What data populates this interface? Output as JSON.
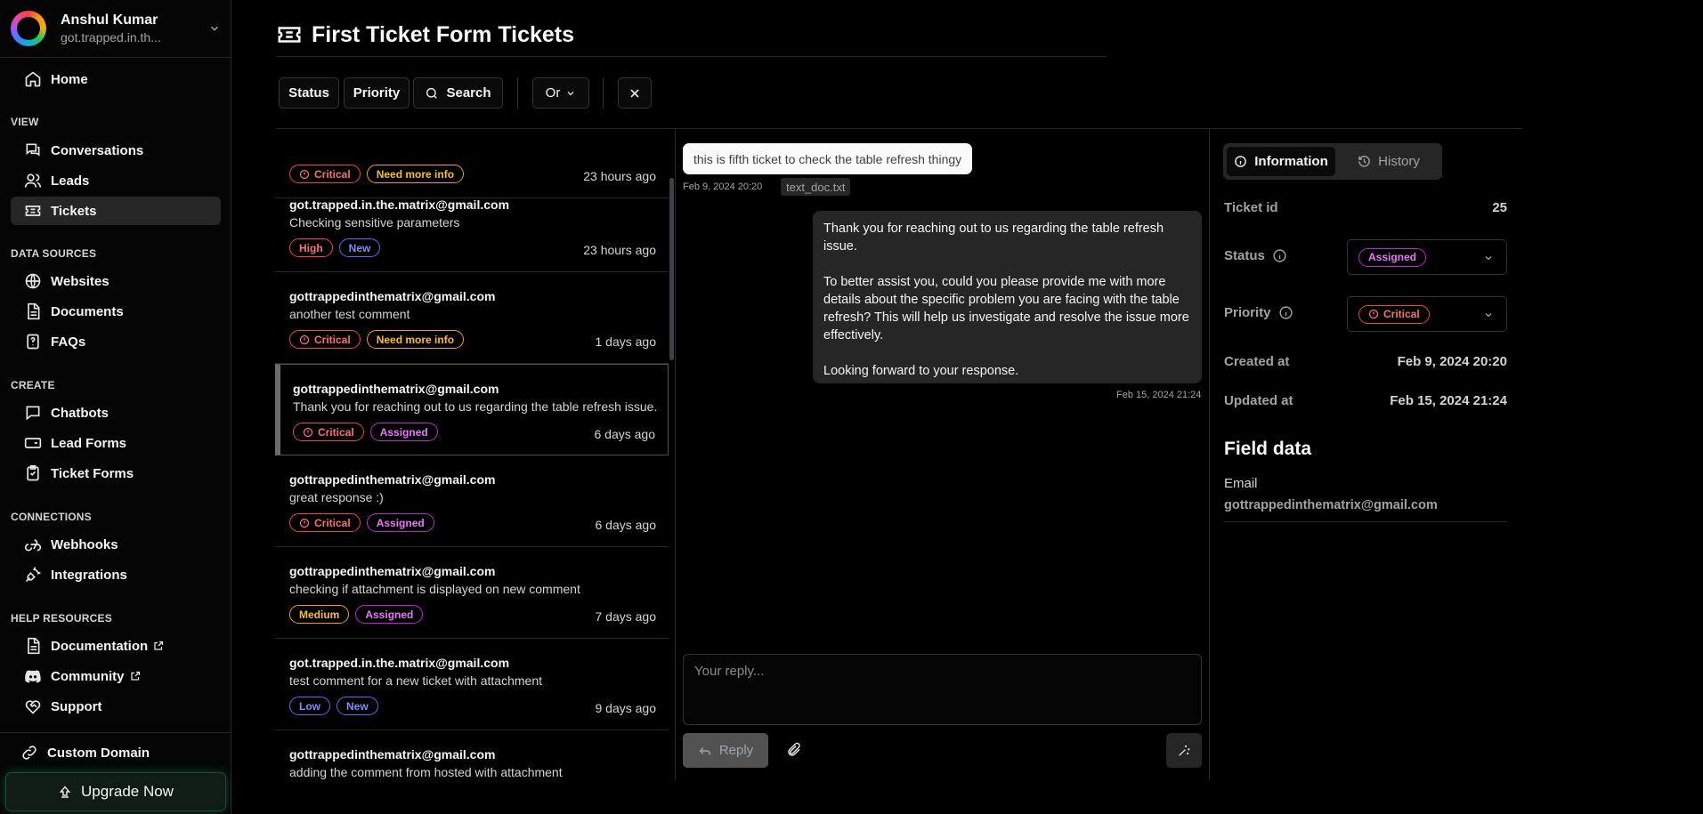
{
  "account": {
    "name": "Anshul Kumar",
    "email": "got.trapped.in.th..."
  },
  "nav": {
    "home": "Home",
    "view_section": "VIEW",
    "conversations": "Conversations",
    "leads": "Leads",
    "tickets": "Tickets",
    "data_section": "DATA SOURCES",
    "websites": "Websites",
    "documents": "Documents",
    "faqs": "FAQs",
    "create_section": "CREATE",
    "chatbots": "Chatbots",
    "lead_forms": "Lead Forms",
    "ticket_forms": "Ticket Forms",
    "connections_section": "CONNECTIONS",
    "webhooks": "Webhooks",
    "integrations": "Integrations",
    "help_section": "HELP RESOURCES",
    "documentation": "Documentation",
    "community": "Community",
    "support": "Support",
    "custom_domain": "Custom Domain",
    "upgrade": "Upgrade Now"
  },
  "page": {
    "title": "First Ticket Form Tickets"
  },
  "filters": {
    "status": "Status",
    "priority": "Priority",
    "search": "Search",
    "operator": "Or"
  },
  "tickets": [
    {
      "email": "",
      "message": "",
      "badges": [
        {
          "label": "Critical",
          "kind": "crit",
          "icon": true
        },
        {
          "label": "Need more info",
          "kind": "info",
          "icon": false
        }
      ],
      "time": "23 hours ago"
    },
    {
      "email": "got.trapped.in.the.matrix@gmail.com",
      "message": "Checking sensitive parameters",
      "badges": [
        {
          "label": "High",
          "kind": "high",
          "icon": false
        },
        {
          "label": "New",
          "kind": "new",
          "icon": false
        }
      ],
      "time": "23 hours ago"
    },
    {
      "email": "gottrappedinthematrix@gmail.com",
      "message": "another test comment",
      "badges": [
        {
          "label": "Critical",
          "kind": "crit",
          "icon": true
        },
        {
          "label": "Need more info",
          "kind": "info",
          "icon": false
        }
      ],
      "time": "1 days ago"
    },
    {
      "email": "gottrappedinthematrix@gmail.com",
      "message": "Thank you for reaching out to us regarding the table refresh issue.",
      "badges": [
        {
          "label": "Critical",
          "kind": "crit",
          "icon": true
        },
        {
          "label": "Assigned",
          "kind": "assigned",
          "icon": false
        }
      ],
      "time": "6 days ago",
      "selected": true
    },
    {
      "email": "gottrappedinthematrix@gmail.com",
      "message": "great response :)",
      "badges": [
        {
          "label": "Critical",
          "kind": "crit",
          "icon": true
        },
        {
          "label": "Assigned",
          "kind": "assigned",
          "icon": false
        }
      ],
      "time": "6 days ago"
    },
    {
      "email": "gottrappedinthematrix@gmail.com",
      "message": "checking if attachment is displayed on new comment",
      "badges": [
        {
          "label": "Medium",
          "kind": "med",
          "icon": false
        },
        {
          "label": "Assigned",
          "kind": "assigned",
          "icon": false
        }
      ],
      "time": "7 days ago"
    },
    {
      "email": "got.trapped.in.the.matrix@gmail.com",
      "message": "test comment for a new ticket with attachment",
      "badges": [
        {
          "label": "Low",
          "kind": "low",
          "icon": false
        },
        {
          "label": "New",
          "kind": "new",
          "icon": false
        }
      ],
      "time": "9 days ago"
    },
    {
      "email": "gottrappedinthematrix@gmail.com",
      "message": "adding the comment from hosted with attachment",
      "badges": [
        {
          "label": "",
          "kind": "crit",
          "icon": false
        },
        {
          "label": "",
          "kind": "assigned",
          "icon": false
        }
      ],
      "time": ""
    }
  ],
  "conversation": {
    "user_message": "this is fifth ticket to check the table refresh thingy",
    "user_time": "Feb 9, 2024 20:20",
    "attachment": "text_doc.txt",
    "bot_paragraphs": [
      "Thank you for reaching out to us regarding the table refresh issue.",
      "To better assist you, could you please provide me with more details about the specific problem you are facing with the table refresh? This will help us investigate and resolve the issue more effectively.",
      "Looking forward to your response."
    ],
    "bot_time": "Feb 15, 2024 21:24",
    "reply_placeholder": "Your reply...",
    "reply_label": "Reply"
  },
  "info": {
    "tab_information": "Information",
    "tab_history": "History",
    "ticket_id_label": "Ticket id",
    "ticket_id": "25",
    "status_label": "Status",
    "status_value": "Assigned",
    "priority_label": "Priority",
    "priority_value": "Critical",
    "created_label": "Created at",
    "created_value": "Feb 9, 2024 20:20",
    "updated_label": "Updated at",
    "updated_value": "Feb 15, 2024 21:24",
    "field_data_title": "Field data",
    "email_label": "Email",
    "email_value": "gottrappedinthematrix@gmail.com"
  }
}
